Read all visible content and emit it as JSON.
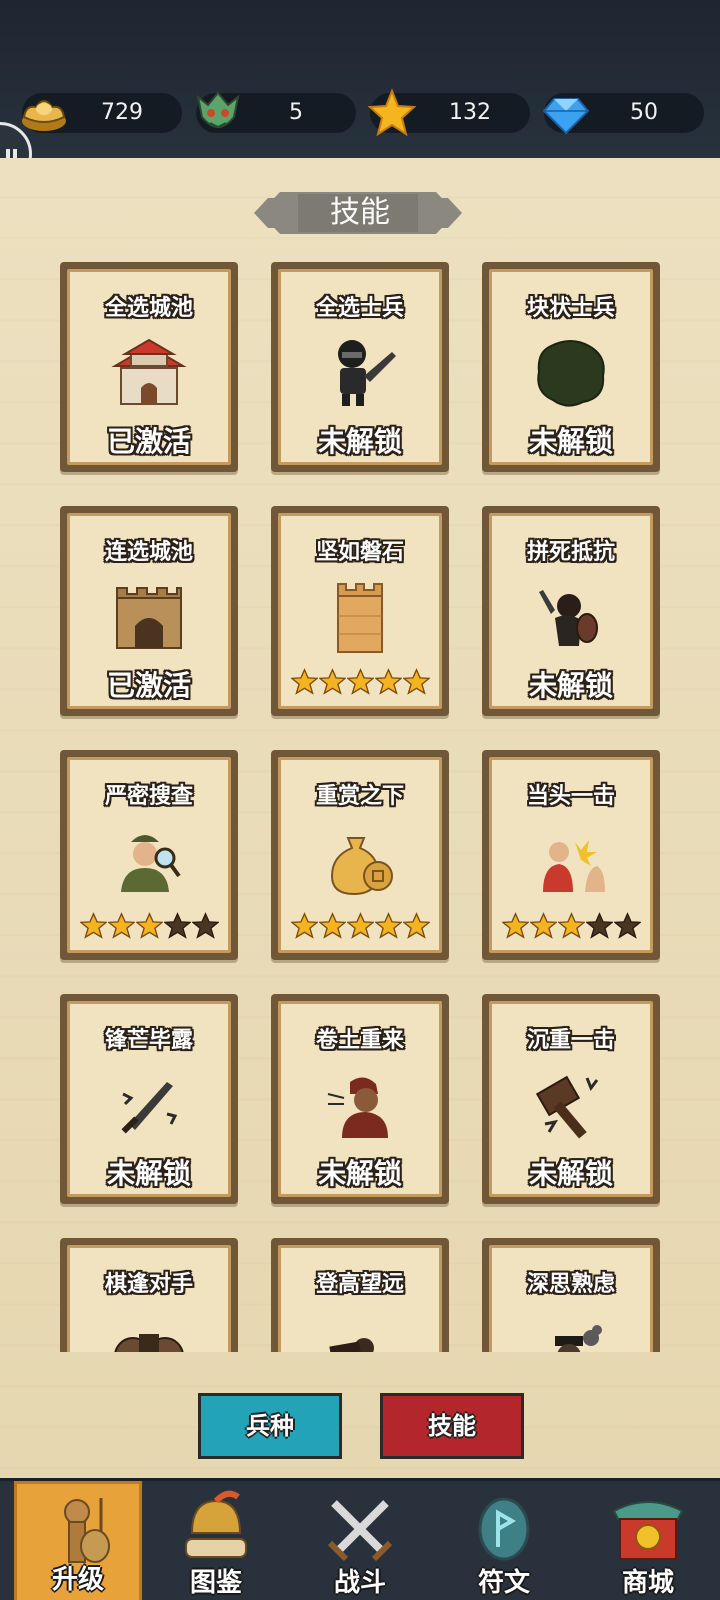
{
  "resources": [
    {
      "icon": "gold-ingot-icon",
      "value": "729"
    },
    {
      "icon": "dragon-mask-icon",
      "value": "5"
    },
    {
      "icon": "star-icon",
      "value": "132"
    },
    {
      "icon": "diamond-icon",
      "value": "50"
    }
  ],
  "page_title": "技能",
  "cards": [
    {
      "name": "全选城池",
      "icon": "red-castle-icon",
      "status": "已激活"
    },
    {
      "name": "全选士兵",
      "icon": "soldier-sword-icon",
      "status": "未解锁"
    },
    {
      "name": "块状士兵",
      "icon": "dark-blob-icon",
      "status": "未解锁"
    },
    {
      "name": "连选城池",
      "icon": "fortress-gate-icon",
      "status": "已激活"
    },
    {
      "name": "坚如磐石",
      "icon": "stone-tower-icon",
      "stars": 5,
      "stars_filled": 5
    },
    {
      "name": "拼死抵抗",
      "icon": "shield-warrior-icon",
      "status": "未解锁"
    },
    {
      "name": "严密搜查",
      "icon": "magnifier-officer-icon",
      "stars": 5,
      "stars_filled": 3
    },
    {
      "name": "重赏之下",
      "icon": "money-bag-icon",
      "stars": 5,
      "stars_filled": 5
    },
    {
      "name": "当头一击",
      "icon": "strike-icon",
      "stars": 5,
      "stars_filled": 3
    },
    {
      "name": "锋芒毕露",
      "icon": "sharp-sword-icon",
      "status": "未解锁"
    },
    {
      "name": "卷土重来",
      "icon": "returning-warrior-icon",
      "status": "未解锁"
    },
    {
      "name": "沉重一击",
      "icon": "hammer-icon",
      "status": "未解锁"
    },
    {
      "name": "棋逢对手",
      "icon": "chess-pieces-icon"
    },
    {
      "name": "登高望远",
      "icon": "telescope-icon"
    },
    {
      "name": "深思熟虑",
      "icon": "thinker-icon"
    }
  ],
  "tabs": {
    "troops": "兵种",
    "skills": "技能"
  },
  "nav": [
    {
      "label": "升级",
      "icon": "upgrade-dummy-icon",
      "active": true
    },
    {
      "label": "图鉴",
      "icon": "codex-helmet-icon",
      "active": false
    },
    {
      "label": "战斗",
      "icon": "crossed-swords-icon",
      "active": false
    },
    {
      "label": "符文",
      "icon": "rune-stone-icon",
      "active": false
    },
    {
      "label": "商城",
      "icon": "shop-gate-icon",
      "active": false
    }
  ],
  "colors": {
    "paper": "#e9dbb6",
    "topbar": "#1d2631",
    "star_filled": "#f4b41f",
    "star_empty": "#4a3520",
    "tab_blue": "#23a3b7",
    "tab_red": "#b3262b",
    "nav_active": "#e7a33a"
  }
}
